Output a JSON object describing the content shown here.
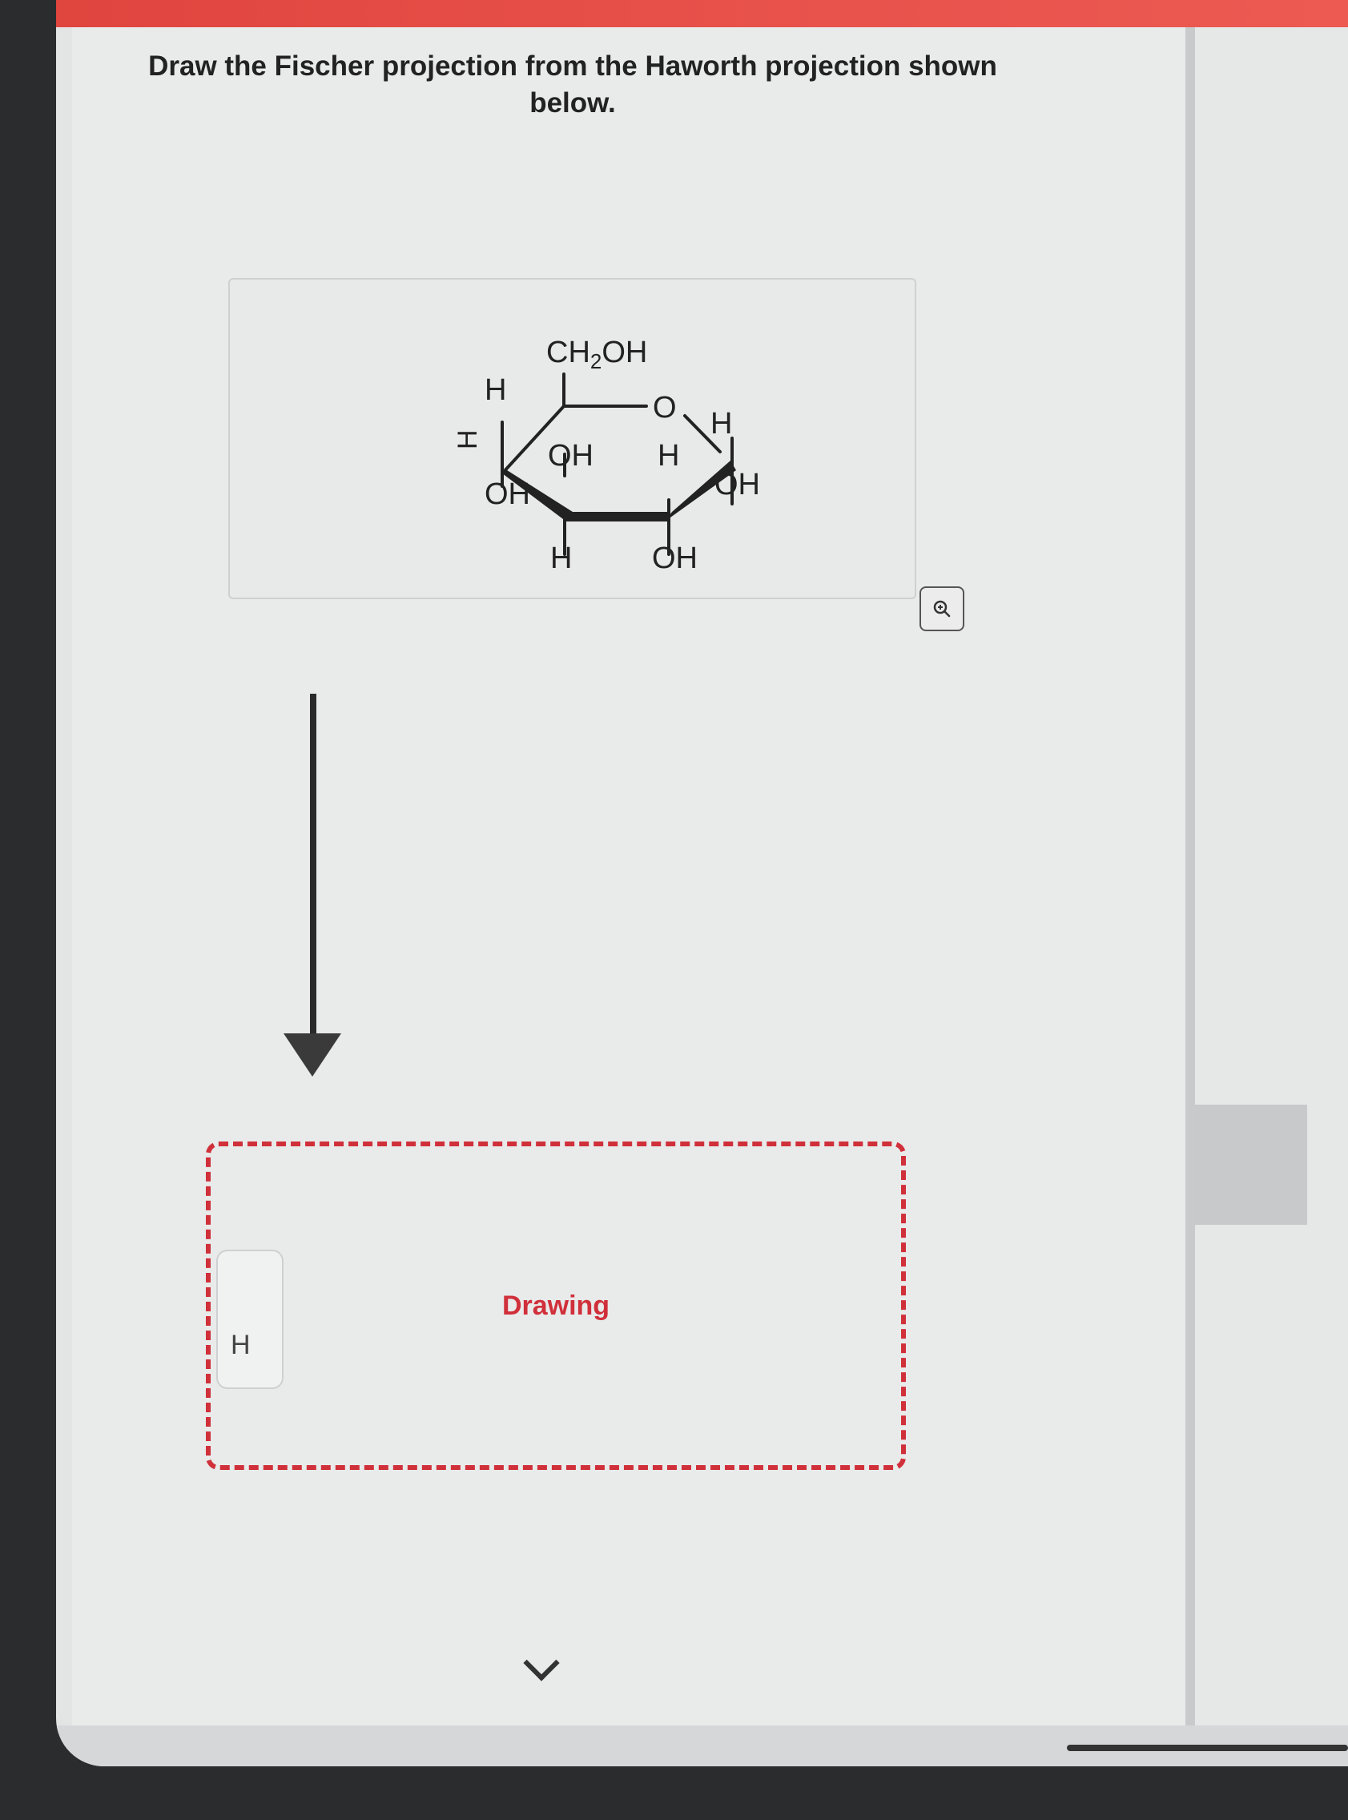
{
  "question": {
    "line1": "Draw the Fischer projection from the Haworth projection shown",
    "line2": "below."
  },
  "molecule": {
    "top_group": "CH₂OH",
    "ring_oxygen": "O",
    "c1_top": "H",
    "c1_bottom": "OH",
    "c2_top": "H",
    "c2_bottom": "OH",
    "c3_top": "H",
    "c3_bottom": "OH",
    "c4_top": "OH",
    "c4_bottom": "H",
    "c5_left": "H"
  },
  "zoom": {
    "icon": "zoom-in-icon"
  },
  "drawing": {
    "label": "Drawing"
  },
  "side": {
    "glyph": "H"
  },
  "colors": {
    "accent": "#d0303a",
    "top_bar": "#e8534c"
  }
}
